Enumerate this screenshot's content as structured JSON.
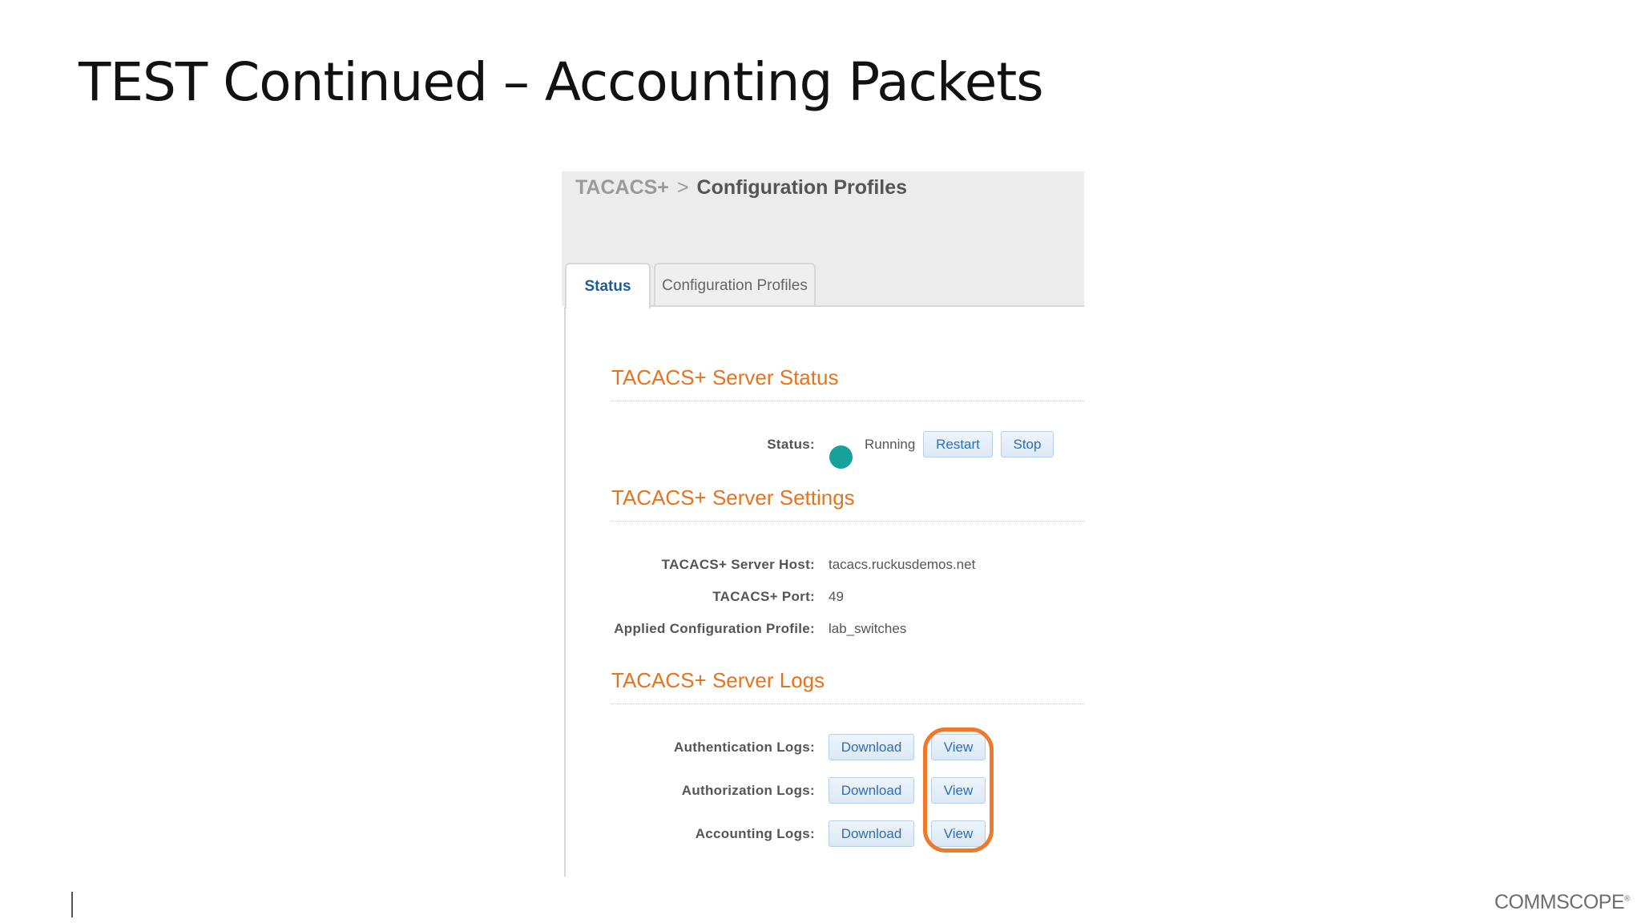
{
  "slide": {
    "title": "TEST Continued – Accounting Packets",
    "logo_text": "COMMSCOPE",
    "logo_mark": "®"
  },
  "breadcrumb": {
    "root": "TACACS+",
    "separator": ">",
    "current": "Configuration Profiles"
  },
  "tabs": {
    "status": "Status",
    "profiles": "Configuration Profiles"
  },
  "server_status": {
    "section_title": "TACACS+ Server Status",
    "label": "Status:",
    "value": "Running",
    "indicator_color": "#17a19b",
    "restart_label": "Restart",
    "stop_label": "Stop"
  },
  "server_settings": {
    "section_title": "TACACS+ Server Settings",
    "host_label": "TACACS+ Server Host:",
    "host_value": "tacacs.ruckusdemos.net",
    "port_label": "TACACS+ Port:",
    "port_value": "49",
    "profile_label": "Applied Configuration Profile:",
    "profile_value": "lab_switches"
  },
  "server_logs": {
    "section_title": "TACACS+ Server Logs",
    "rows": [
      {
        "label": "Authentication Logs:",
        "download": "Download",
        "view": "View"
      },
      {
        "label": "Authorization Logs:",
        "download": "Download",
        "view": "View"
      },
      {
        "label": "Accounting Logs:",
        "download": "Download",
        "view": "View"
      }
    ]
  },
  "colors": {
    "accent": "#e8731d",
    "link_blue": "#2a6fb7",
    "highlight": "#f0782b"
  }
}
